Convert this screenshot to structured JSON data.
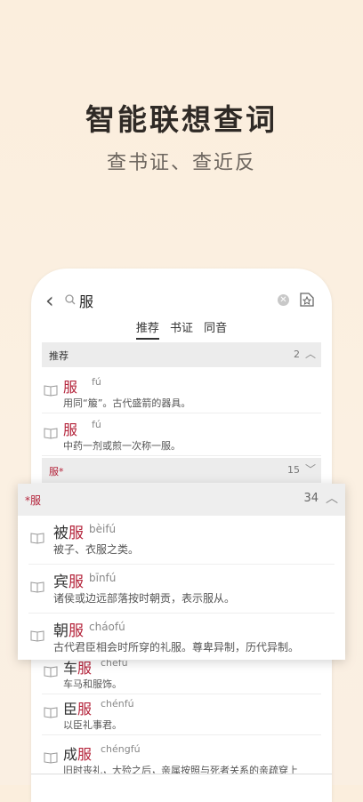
{
  "hero": {
    "title": "智能联想查词",
    "subtitle": "查书证、查近反"
  },
  "search": {
    "query": "服"
  },
  "tabs": [
    "推荐",
    "书证",
    "同音"
  ],
  "section_recommend": {
    "label": "推荐",
    "count": "2"
  },
  "recommend_items": [
    {
      "word": "服",
      "pinyin": "fú",
      "def": "用同“箙”。古代盛箭的器具。"
    },
    {
      "word": "服",
      "pinyin": "fú",
      "def": "中药一剂或煎一次称一服。"
    }
  ],
  "section_fu_star": {
    "label": "服*",
    "count": "15"
  },
  "popup": {
    "label": "*服",
    "count": "34",
    "items": [
      {
        "prefix": "被",
        "hl": "服",
        "pinyin": "bèifú",
        "def": "被子、衣服之类。"
      },
      {
        "prefix": "宾",
        "hl": "服",
        "pinyin": "bīnfú",
        "def": "诸侯或边远部落按时朝贡，表示服从。"
      },
      {
        "prefix": "朝",
        "hl": "服",
        "pinyin": "cháofú",
        "def": "古代君臣相会时所穿的礼服。尊卑异制，历代异制。"
      }
    ]
  },
  "below_items": [
    {
      "prefix": "车",
      "hl": "服",
      "pinyin": "chēfú",
      "def": "车马和服饰。"
    },
    {
      "prefix": "臣",
      "hl": "服",
      "pinyin": "chénfú",
      "def": "以臣礼事君。"
    },
    {
      "prefix": "成",
      "hl": "服",
      "pinyin": "chéngfú",
      "def": "旧时丧礼，大殓之后，亲属按照与死者关系的亲疏穿上"
    }
  ],
  "colors": {
    "accent": "#b4233a",
    "background": "#fbeedd"
  }
}
